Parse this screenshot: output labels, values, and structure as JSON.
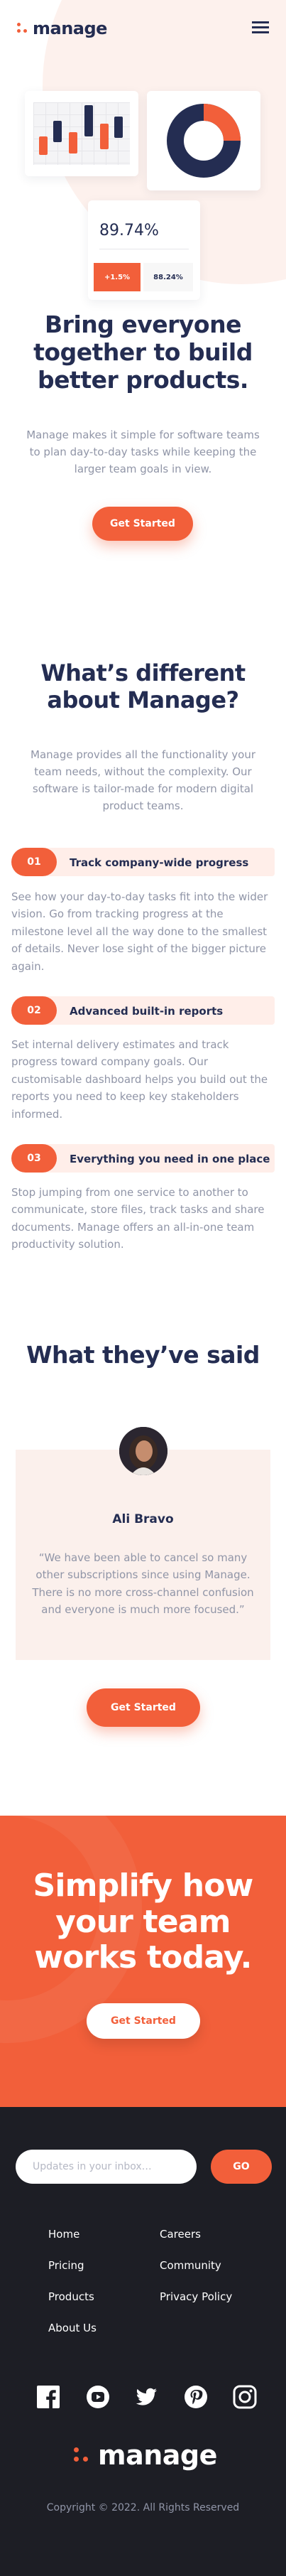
{
  "brand": {
    "name": "manage",
    "accent": "#f25f3a",
    "navy": "#242d52",
    "footer_bg": "#1d1e25"
  },
  "header": {
    "menu_icon": "hamburger-icon"
  },
  "hero": {
    "stats": {
      "main_value": "89.74%",
      "change_value": "+1.5%",
      "secondary_value": "88.24%"
    },
    "title": "Bring everyone together to build better products.",
    "subtitle": "Manage makes it simple for software teams to plan day-to-day tasks while keeping the larger team goals in view.",
    "cta_label": "Get Started"
  },
  "features": {
    "title": "What’s different about Manage?",
    "subtitle": "Manage provides all the functionality your team needs, without the complexity. Our software is tailor-made for modern digital product teams.",
    "items": [
      {
        "number": "01",
        "title": "Track company-wide progress",
        "body": "See how your day-to-day tasks fit into the wider vision. Go from tracking progress at the milestone level all the way done to the smallest of details. Never lose sight of the bigger picture again."
      },
      {
        "number": "02",
        "title": "Advanced built-in reports",
        "body": "Set internal delivery estimates and track progress toward company goals. Our customisable dashboard helps you build out the reports you need to keep key stakeholders informed."
      },
      {
        "number": "03",
        "title": "Everything you need in one place",
        "body": "Stop jumping from one service to another to communicate, store files, track tasks and share documents. Manage offers an all-in-one team productivity solution."
      }
    ]
  },
  "testimonials": {
    "title": "What they’ve said",
    "name": "Ali Bravo",
    "quote": "“We have been able to cancel so many other subscriptions since using Manage. There is no more cross-channel confusion and everyone is much more focused.”",
    "cta_label": "Get Started"
  },
  "cta": {
    "title": "Simplify how your team works today.",
    "button_label": "Get Started"
  },
  "footer": {
    "newsletter_placeholder": "Updates in your inbox…",
    "go_label": "GO",
    "links_col1": [
      "Home",
      "Pricing",
      "Products",
      "About Us"
    ],
    "links_col2": [
      "Careers",
      "Community",
      "Privacy Policy"
    ],
    "socials": [
      "facebook-icon",
      "youtube-icon",
      "twitter-icon",
      "pinterest-icon",
      "instagram-icon"
    ],
    "logo_text": "manage",
    "copyright": "Copyright © 2022. All Rights Reserved"
  }
}
